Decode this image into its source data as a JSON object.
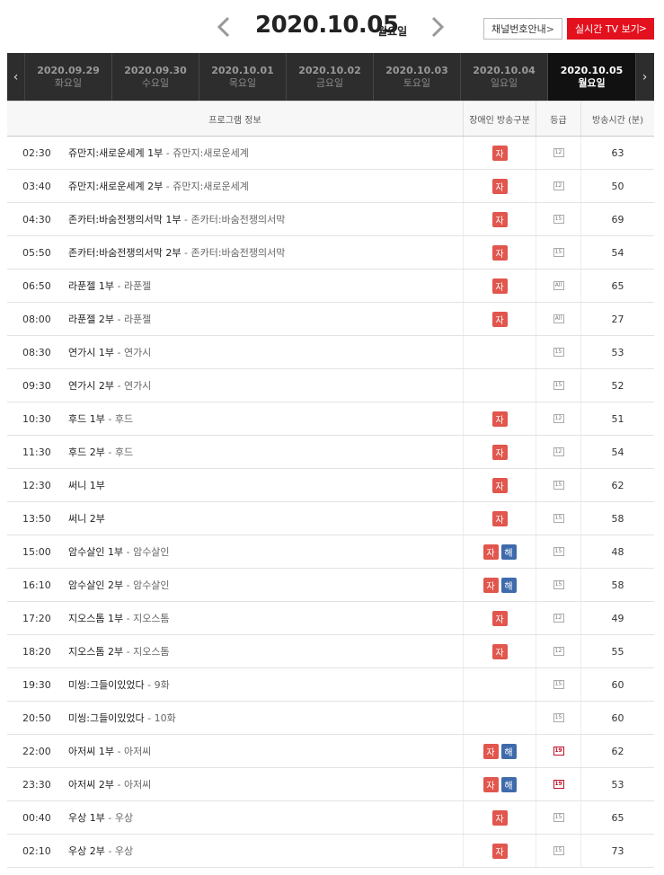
{
  "header": {
    "date": "2020.10.05",
    "weekday": "월요일",
    "guide_button": "채널번호안내",
    "live_button": "실시간 TV 보기"
  },
  "tabs": [
    {
      "date": "2020.09.29",
      "weekday": "화요일",
      "active": false
    },
    {
      "date": "2020.09.30",
      "weekday": "수요일",
      "active": false
    },
    {
      "date": "2020.10.01",
      "weekday": "목요일",
      "active": false
    },
    {
      "date": "2020.10.02",
      "weekday": "금요일",
      "active": false
    },
    {
      "date": "2020.10.03",
      "weekday": "토요일",
      "active": false
    },
    {
      "date": "2020.10.04",
      "weekday": "일요일",
      "active": false
    },
    {
      "date": "2020.10.05",
      "weekday": "월요일",
      "active": true
    }
  ],
  "columns": {
    "info": "프로그램 정보",
    "disability": "장애인 방송구분",
    "grade": "등급",
    "duration": "방송시간 (분)"
  },
  "badge_labels": {
    "ja": "자",
    "hae": "해"
  },
  "rows": [
    {
      "time": "02:30",
      "title": "쥬만지:새로운세계 1부",
      "sub": " - 쥬만지:새로운세계",
      "badges": [
        "ja"
      ],
      "grade": "12",
      "duration": "63"
    },
    {
      "time": "03:40",
      "title": "쥬만지:새로운세계 2부",
      "sub": " - 쥬만지:새로운세계",
      "badges": [
        "ja"
      ],
      "grade": "12",
      "duration": "50"
    },
    {
      "time": "04:30",
      "title": "존카터:바숨전쟁의서막 1부",
      "sub": " - 존카터:바숨전쟁의서막",
      "badges": [
        "ja"
      ],
      "grade": "15",
      "duration": "69"
    },
    {
      "time": "05:50",
      "title": "존카터:바숨전쟁의서막 2부",
      "sub": " - 존카터:바숨전쟁의서막",
      "badges": [
        "ja"
      ],
      "grade": "15",
      "duration": "54"
    },
    {
      "time": "06:50",
      "title": "라푼젤 1부",
      "sub": " - 라푼젤",
      "badges": [
        "ja"
      ],
      "grade": "All",
      "duration": "65"
    },
    {
      "time": "08:00",
      "title": "라푼젤 2부",
      "sub": " - 라푼젤",
      "badges": [
        "ja"
      ],
      "grade": "All",
      "duration": "27"
    },
    {
      "time": "08:30",
      "title": "연가시 1부",
      "sub": " - 연가시",
      "badges": [],
      "grade": "15",
      "duration": "53"
    },
    {
      "time": "09:30",
      "title": "연가시 2부",
      "sub": " - 연가시",
      "badges": [],
      "grade": "15",
      "duration": "52"
    },
    {
      "time": "10:30",
      "title": "후드 1부",
      "sub": " - 후드",
      "badges": [
        "ja"
      ],
      "grade": "12",
      "duration": "51"
    },
    {
      "time": "11:30",
      "title": "후드 2부",
      "sub": " - 후드",
      "badges": [
        "ja"
      ],
      "grade": "12",
      "duration": "54"
    },
    {
      "time": "12:30",
      "title": "써니 1부",
      "sub": "",
      "badges": [
        "ja"
      ],
      "grade": "15",
      "duration": "62"
    },
    {
      "time": "13:50",
      "title": "써니 2부",
      "sub": "",
      "badges": [
        "ja"
      ],
      "grade": "15",
      "duration": "58"
    },
    {
      "time": "15:00",
      "title": "암수살인 1부",
      "sub": " - 암수살인",
      "badges": [
        "ja",
        "hae"
      ],
      "grade": "15",
      "duration": "48"
    },
    {
      "time": "16:10",
      "title": "암수살인 2부",
      "sub": " - 암수살인",
      "badges": [
        "ja",
        "hae"
      ],
      "grade": "15",
      "duration": "58"
    },
    {
      "time": "17:20",
      "title": "지오스톰 1부",
      "sub": " - 지오스톰",
      "badges": [
        "ja"
      ],
      "grade": "12",
      "duration": "49"
    },
    {
      "time": "18:20",
      "title": "지오스톰 2부",
      "sub": " - 지오스톰",
      "badges": [
        "ja"
      ],
      "grade": "12",
      "duration": "55"
    },
    {
      "time": "19:30",
      "title": "미씽:그들이있었다",
      "sub": " - 9화",
      "badges": [],
      "grade": "15",
      "duration": "60"
    },
    {
      "time": "20:50",
      "title": "미씽:그들이있었다",
      "sub": " - 10화",
      "badges": [],
      "grade": "15",
      "duration": "60"
    },
    {
      "time": "22:00",
      "title": "아저씨 1부",
      "sub": " - 아저씨",
      "badges": [
        "ja",
        "hae"
      ],
      "grade": "19",
      "duration": "62"
    },
    {
      "time": "23:30",
      "title": "아저씨 2부",
      "sub": " - 아저씨",
      "badges": [
        "ja",
        "hae"
      ],
      "grade": "19",
      "duration": "53"
    },
    {
      "time": "00:40",
      "title": "우상 1부",
      "sub": " - 우상",
      "badges": [
        "ja"
      ],
      "grade": "15",
      "duration": "65"
    },
    {
      "time": "02:10",
      "title": "우상 2부",
      "sub": " - 우상",
      "badges": [
        "ja"
      ],
      "grade": "15",
      "duration": "73"
    }
  ]
}
